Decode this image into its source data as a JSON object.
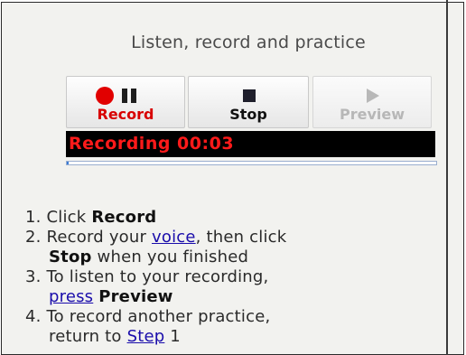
{
  "header": {
    "title": "Listen, record and practice"
  },
  "controls": {
    "record_label": "Record",
    "stop_label": "Stop",
    "preview_label": "Preview",
    "record_icon": "record-dot-icon",
    "pause_icon": "pause-icon",
    "stop_icon": "stop-square-icon",
    "preview_icon": "play-icon"
  },
  "status": {
    "text": "Recording 00:03",
    "progress": 0.005
  },
  "steps": [
    {
      "num": "1.",
      "pre": "Click ",
      "bold": "Record"
    },
    {
      "num": "2.",
      "pre": "Record your ",
      "link": "voice",
      "post": ", then click",
      "bold": "Stop",
      "tail": " when you finished"
    },
    {
      "num": "3.",
      "pre": "To listen to your recording,",
      "link": "press",
      "bold": "Preview"
    },
    {
      "num": "4.",
      "pre": "To record another practice,",
      "cont_pre": "return to ",
      "link": "Step",
      "post": " 1"
    }
  ],
  "colors": {
    "record_red": "#e10000",
    "status_bg": "#000000",
    "status_text": "#ff1a1a",
    "link": "#1a0dab",
    "panel_bg": "#f2f2ef"
  }
}
